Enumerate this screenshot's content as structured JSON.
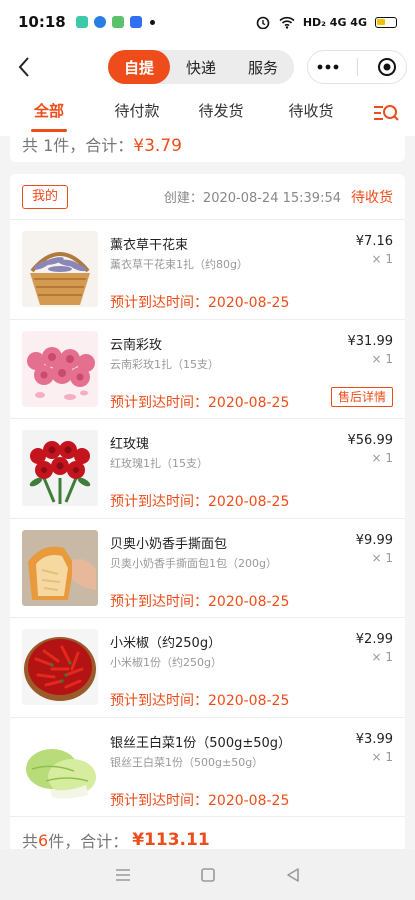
{
  "status_bar": {
    "time": "10:18",
    "network": "HD₂ 4G 4G"
  },
  "header": {
    "segments": [
      "自提",
      "快递",
      "服务"
    ],
    "active_segment": 0
  },
  "tabs": [
    "全部",
    "待付款",
    "待发货",
    "待收货"
  ],
  "previous_order": {
    "count_prefix": "共 1件，合计：",
    "amount": "¥3.79"
  },
  "order": {
    "badge": "我的",
    "created": "创建：2020-08-24 15:39:54",
    "status": "待收货",
    "items": [
      {
        "name": "薰衣草干花束",
        "spec": "薰衣草干花束1扎（约80g）",
        "price": "¥7.16",
        "qty": "× 1",
        "eta": "预计到达时间：2020-08-25",
        "thumb": "lavender-bouquet-image"
      },
      {
        "name": "云南彩玫",
        "spec": "云南彩玫1扎（15支）",
        "price": "¥31.99",
        "qty": "× 1",
        "eta": "预计到达时间：2020-08-25",
        "aftersale": "售后详情",
        "thumb": "pink-roses-image"
      },
      {
        "name": "红玫瑰",
        "spec": "红玫瑰1扎（15支）",
        "price": "¥56.99",
        "qty": "× 1",
        "eta": "预计到达时间：2020-08-25",
        "thumb": "red-roses-image"
      },
      {
        "name": "贝奥小奶香手撕面包",
        "spec": "贝奥小奶香手撕面包1包（200g）",
        "price": "¥9.99",
        "qty": "× 1",
        "eta": "预计到达时间：2020-08-25",
        "thumb": "bread-image"
      },
      {
        "name": "小米椒（约250g）",
        "spec": "小米椒1份（约250g）",
        "price": "¥2.99",
        "qty": "× 1",
        "eta": "预计到达时间：2020-08-25",
        "thumb": "red-chili-image"
      },
      {
        "name": "银丝王白菜1份（500g±50g）",
        "spec": "银丝王白菜1份（500g±50g）",
        "price": "¥3.99",
        "qty": "× 1",
        "eta": "预计到达时间：2020-08-25",
        "thumb": "napa-cabbage-image"
      }
    ],
    "total_prefix": "共 ",
    "total_count": "6",
    "total_mid": "件，合计：",
    "total_amount": "¥113.11"
  },
  "colors": {
    "accent": "#ee4d1b"
  }
}
